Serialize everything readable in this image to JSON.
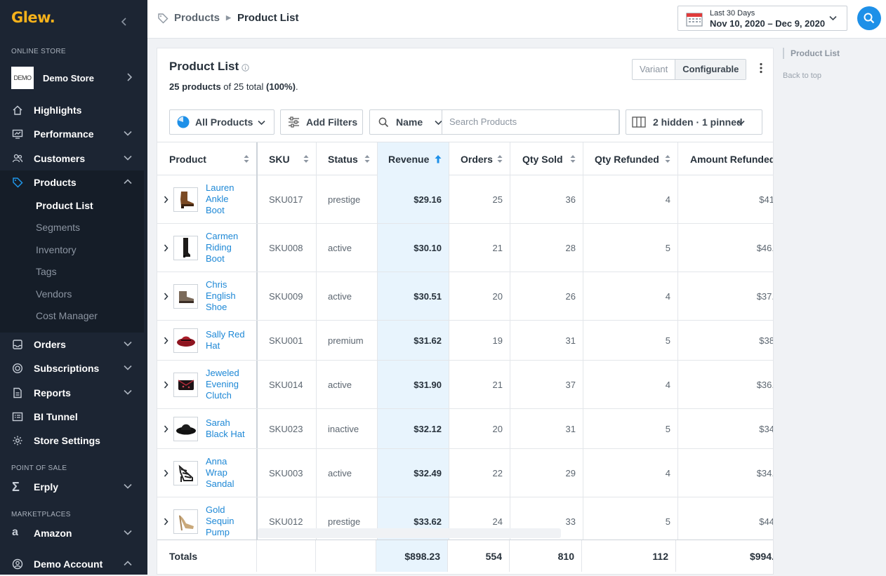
{
  "app": {
    "logo": "Glew."
  },
  "sidebar": {
    "online_store_label": "ONLINE STORE",
    "store": {
      "logo_text": "DEMO",
      "name": "Demo Store"
    },
    "items": [
      {
        "label": "Highlights",
        "icon": "home-icon"
      },
      {
        "label": "Performance",
        "icon": "monitor-icon"
      },
      {
        "label": "Customers",
        "icon": "people-icon"
      },
      {
        "label": "Products",
        "icon": "tag-icon"
      },
      {
        "label": "Orders",
        "icon": "inbox-icon"
      },
      {
        "label": "Subscriptions",
        "icon": "refresh-circle-icon"
      },
      {
        "label": "Reports",
        "icon": "document-icon"
      },
      {
        "label": "BI Tunnel",
        "icon": "list-box-icon"
      },
      {
        "label": "Store Settings",
        "icon": "gear-icon"
      }
    ],
    "products_sub": [
      "Product List",
      "Segments",
      "Inventory",
      "Tags",
      "Vendors",
      "Cost Manager"
    ],
    "pos_label": "POINT OF SALE",
    "pos_item": "Erply",
    "marketplaces_label": "MARKETPLACES",
    "marketplace_item": "Amazon",
    "account_item": "Demo Account"
  },
  "header": {
    "breadcrumb": [
      "Products",
      "Product List"
    ],
    "date_range": {
      "label": "Last 30 Days",
      "value": "Nov 10, 2020 – Dec 9, 2020"
    }
  },
  "card": {
    "title": "Product List",
    "summary": {
      "count": "25 products",
      "mid": " of 25 total ",
      "pct": "(100%)",
      "end": "."
    },
    "toggle": {
      "variant": "Variant",
      "configurable": "Configurable"
    },
    "toolbar": {
      "segment": "All Products",
      "filters": "Add Filters",
      "search_field": "Name",
      "search_placeholder": "Search Products",
      "columns": "2 hidden · 1 pinned"
    }
  },
  "table": {
    "columns": [
      "Product",
      "SKU",
      "Status",
      "Revenue",
      "Orders",
      "Qty Sold",
      "Qty Refunded",
      "Amount Refunded"
    ],
    "rows": [
      {
        "name": "Lauren Ankle Boot",
        "sku": "SKU017",
        "status": "prestige",
        "revenue": "$29.16",
        "orders": "25",
        "qty_sold": "36",
        "qty_refunded": "4",
        "amount_refunded": "$41"
      },
      {
        "name": "Carmen Riding Boot",
        "sku": "SKU008",
        "status": "active",
        "revenue": "$30.10",
        "orders": "21",
        "qty_sold": "28",
        "qty_refunded": "5",
        "amount_refunded": "$46."
      },
      {
        "name": "Chris English Shoe",
        "sku": "SKU009",
        "status": "active",
        "revenue": "$30.51",
        "orders": "20",
        "qty_sold": "26",
        "qty_refunded": "4",
        "amount_refunded": "$37."
      },
      {
        "name": "Sally Red Hat",
        "sku": "SKU001",
        "status": "premium",
        "revenue": "$31.62",
        "orders": "19",
        "qty_sold": "31",
        "qty_refunded": "5",
        "amount_refunded": "$38"
      },
      {
        "name": "Jeweled Evening Clutch",
        "sku": "SKU014",
        "status": "active",
        "revenue": "$31.90",
        "orders": "21",
        "qty_sold": "37",
        "qty_refunded": "4",
        "amount_refunded": "$36."
      },
      {
        "name": "Sarah Black Hat",
        "sku": "SKU023",
        "status": "inactive",
        "revenue": "$32.12",
        "orders": "20",
        "qty_sold": "31",
        "qty_refunded": "5",
        "amount_refunded": "$34"
      },
      {
        "name": "Anna Wrap Sandal",
        "sku": "SKU003",
        "status": "active",
        "revenue": "$32.49",
        "orders": "22",
        "qty_sold": "29",
        "qty_refunded": "4",
        "amount_refunded": "$34."
      },
      {
        "name": "Gold Sequin Pump",
        "sku": "SKU012",
        "status": "prestige",
        "revenue": "$33.62",
        "orders": "24",
        "qty_sold": "33",
        "qty_refunded": "5",
        "amount_refunded": "$44"
      }
    ],
    "totals": {
      "label": "Totals",
      "revenue": "$898.23",
      "orders": "554",
      "qty_sold": "810",
      "qty_refunded": "112",
      "amount_refunded": "$994."
    }
  },
  "right_nav": {
    "current": "Product List",
    "back": "Back to top"
  }
}
